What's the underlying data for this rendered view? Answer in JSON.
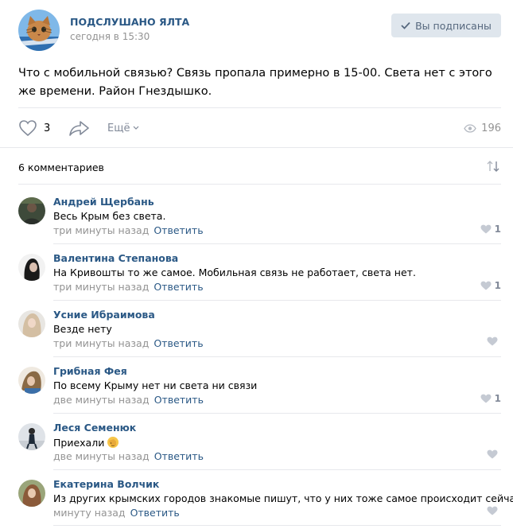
{
  "post": {
    "group_name": "ПОДСЛУШАНО ЯЛТА",
    "date": "сегодня в 15:30",
    "subscribe_label": "Вы подписаны",
    "text": "Что с мобильной связью? Связь пропала примерно в 15-00. Света нет с этого же времени. Район Гнездышко.",
    "likes": "3",
    "more_label": "Ещё",
    "views": "196"
  },
  "comments_header": "6 комментариев",
  "comments": [
    {
      "author": "Андрей Щербань",
      "text": "Весь Крым без света.",
      "time": "три минуты назад",
      "reply": "Ответить",
      "likes": "1"
    },
    {
      "author": "Валентина Степанова",
      "text": "На Кривошты то же самое. Мобильная связь не работает, света нет.",
      "time": "три минуты назад",
      "reply": "Ответить",
      "likes": "1"
    },
    {
      "author": "Усние Ибраимова",
      "text": "Везде нету",
      "time": "три минуты назад",
      "reply": "Ответить",
      "likes": ""
    },
    {
      "author": "Грибная Фея",
      "text": "По всему Крыму нет ни света ни связи",
      "time": "две минуты назад",
      "reply": "Ответить",
      "likes": "1"
    },
    {
      "author": "Леся Семенюк",
      "text": "Приехали",
      "time": "две минуты назад",
      "reply": "Ответить",
      "likes": ""
    },
    {
      "author": "Екатерина Волчик",
      "text": "Из других крымских городов знакомые пишут, что у них тоже самое происходит сейчас.",
      "time": "минуту назад",
      "reply": "Ответить",
      "likes": ""
    }
  ],
  "colors": {
    "link": "#2a5885",
    "muted": "#939393",
    "button_bg": "#dfe6ed",
    "divider": "#e7e8ec"
  },
  "icons": [
    "cat-avatar-icon",
    "check-icon",
    "heart-icon",
    "share-arrow-icon",
    "chevron-down-icon",
    "eye-icon",
    "sort-icon",
    "facepalm-emoji"
  ]
}
